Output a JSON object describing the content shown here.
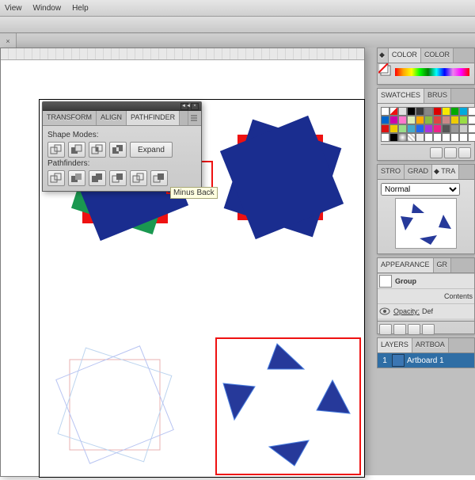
{
  "menubar": {
    "items": [
      "View",
      "Window",
      "Help"
    ]
  },
  "pathfinder": {
    "tabs": [
      "TRANSFORM",
      "ALIGN",
      "PATHFINDER"
    ],
    "active_tab": 2,
    "shape_modes_label": "Shape Modes:",
    "pathfinders_label": "Pathfinders:",
    "expand_label": "Expand",
    "tooltip": "Minus Back"
  },
  "right": {
    "color_tabs": [
      "COLOR",
      "COLOR"
    ],
    "swatches_tabs": [
      "SWATCHES",
      "BRUS"
    ],
    "stroke_tabs": [
      "STRO",
      "GRAD",
      "TRA"
    ],
    "blend_mode": "Normal",
    "appearance_tabs": [
      "APPEARANCE",
      "GR"
    ],
    "appearance_title": "Group",
    "contents_label": "Contents",
    "opacity_label": "Opacity:",
    "opacity_value": "Def",
    "layers_tabs": [
      "LAYERS",
      "ARTBOA"
    ],
    "layer_num": "1",
    "layer_name": "Artboard 1"
  },
  "icons": {
    "close": "×",
    "menu_lines": "≡"
  }
}
